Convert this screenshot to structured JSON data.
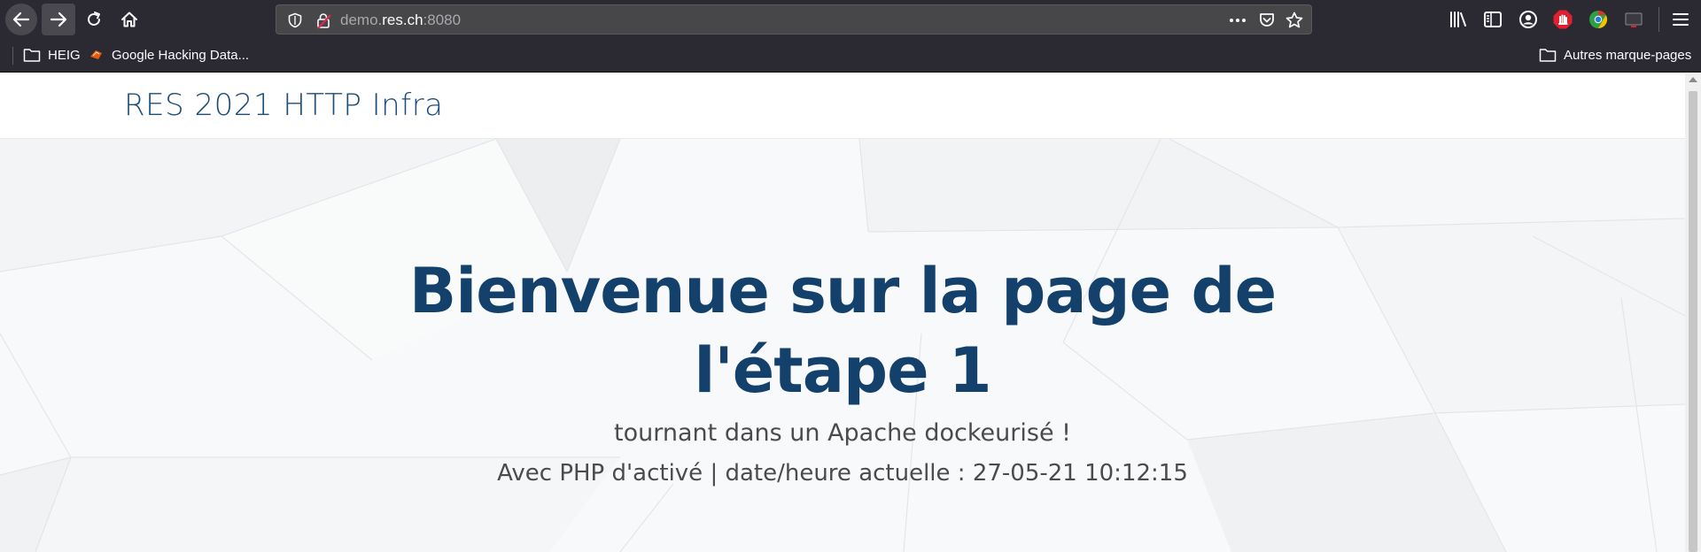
{
  "browser": {
    "url_subdomain": "demo.",
    "url_domain": "res.ch",
    "url_port": ":8080",
    "bookmarks": [
      {
        "label": "HEIG",
        "icon": "folder-icon"
      },
      {
        "label": "Google Hacking Data...",
        "icon": "google-hacking-favicon"
      }
    ],
    "other_bookmarks": "Autres marque-pages"
  },
  "site": {
    "brand": "RES 2021 HTTP Infra",
    "hero_title_line1": "Bienvenue sur la page de",
    "hero_title_line2": "l'étape 1",
    "hero_subtitle": "tournant dans un Apache dockeurisé !",
    "hero_date": "Avec PHP d'activé | date/heure actuelle : 27-05-21 10:12:15"
  },
  "colors": {
    "toolbar_bg": "#2b2a33",
    "brand": "#1d4e7a",
    "hero_title": "#13416b",
    "hero_text": "#4b4b4b"
  }
}
